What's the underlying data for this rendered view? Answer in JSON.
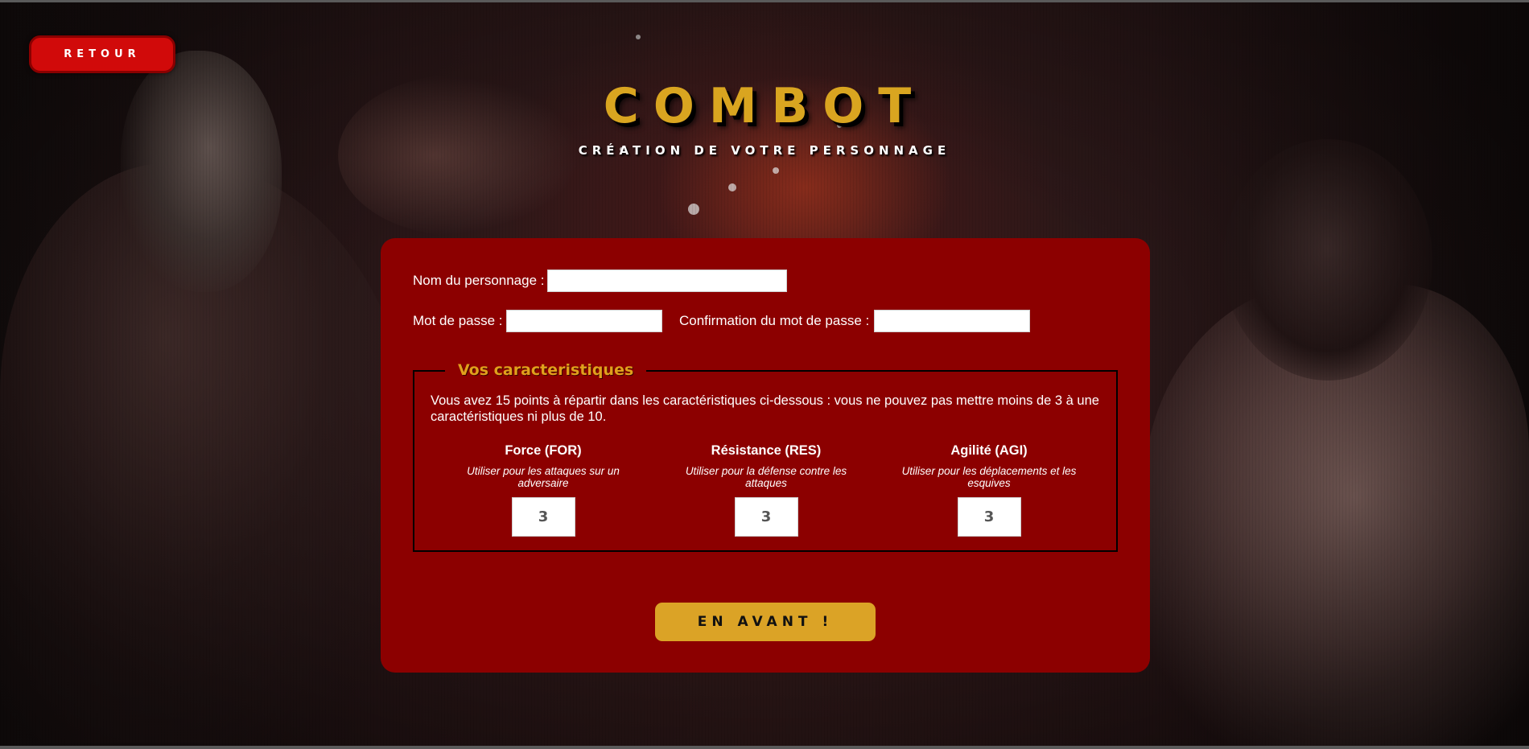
{
  "header": {
    "back_label": "Retour",
    "logo_text": "COMBOT",
    "subtitle": "Création de votre personnage"
  },
  "form": {
    "name_label": "Nom du personnage :",
    "name_value": "",
    "password_label": "Mot de passe :",
    "password_value": "",
    "confirm_label": "Confirmation du mot de passe :",
    "confirm_value": "",
    "submit_label": "En avant !"
  },
  "characteristics": {
    "legend": "Vos caracteristiques",
    "intro": "Vous avez 15 points à répartir dans les caractéristiques ci-dessous : vous ne pouvez pas mettre moins de 3 à une caractéristiques ni plus de 10.",
    "stats": [
      {
        "title": "Force (FOR)",
        "description": "Utiliser pour les attaques sur un adversaire",
        "value": "3"
      },
      {
        "title": "Résistance (RES)",
        "description": "Utiliser pour la défense contre les attaques",
        "value": "3"
      },
      {
        "title": "Agilité (AGI)",
        "description": "Utiliser pour les déplacements et les esquives",
        "value": "3"
      }
    ]
  },
  "colors": {
    "panel": "#8c0000",
    "accent_gold": "#dba326",
    "back_button": "#d10a0a",
    "logo": "#d9a520"
  }
}
